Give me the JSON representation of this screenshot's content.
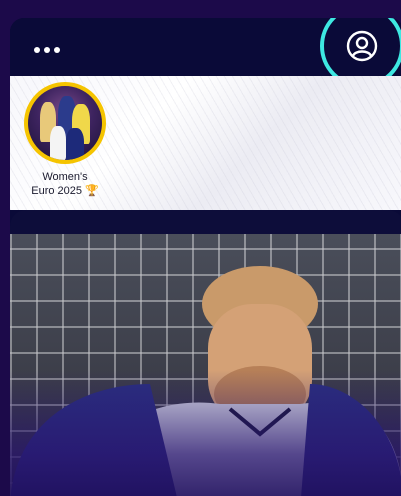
{
  "header": {
    "more_icon": "more-horizontal-icon",
    "profile_icon": "user-circle-icon",
    "accent_color": "#3ee8e2"
  },
  "stories": {
    "items": [
      {
        "label_line1": "Women's",
        "label_line2": "Euro 2025 🏆",
        "ring_color": "#f5c400"
      }
    ]
  },
  "feed": {
    "cards": [
      {
        "image_alt": "footballer-goalkeeper-photo"
      }
    ]
  }
}
